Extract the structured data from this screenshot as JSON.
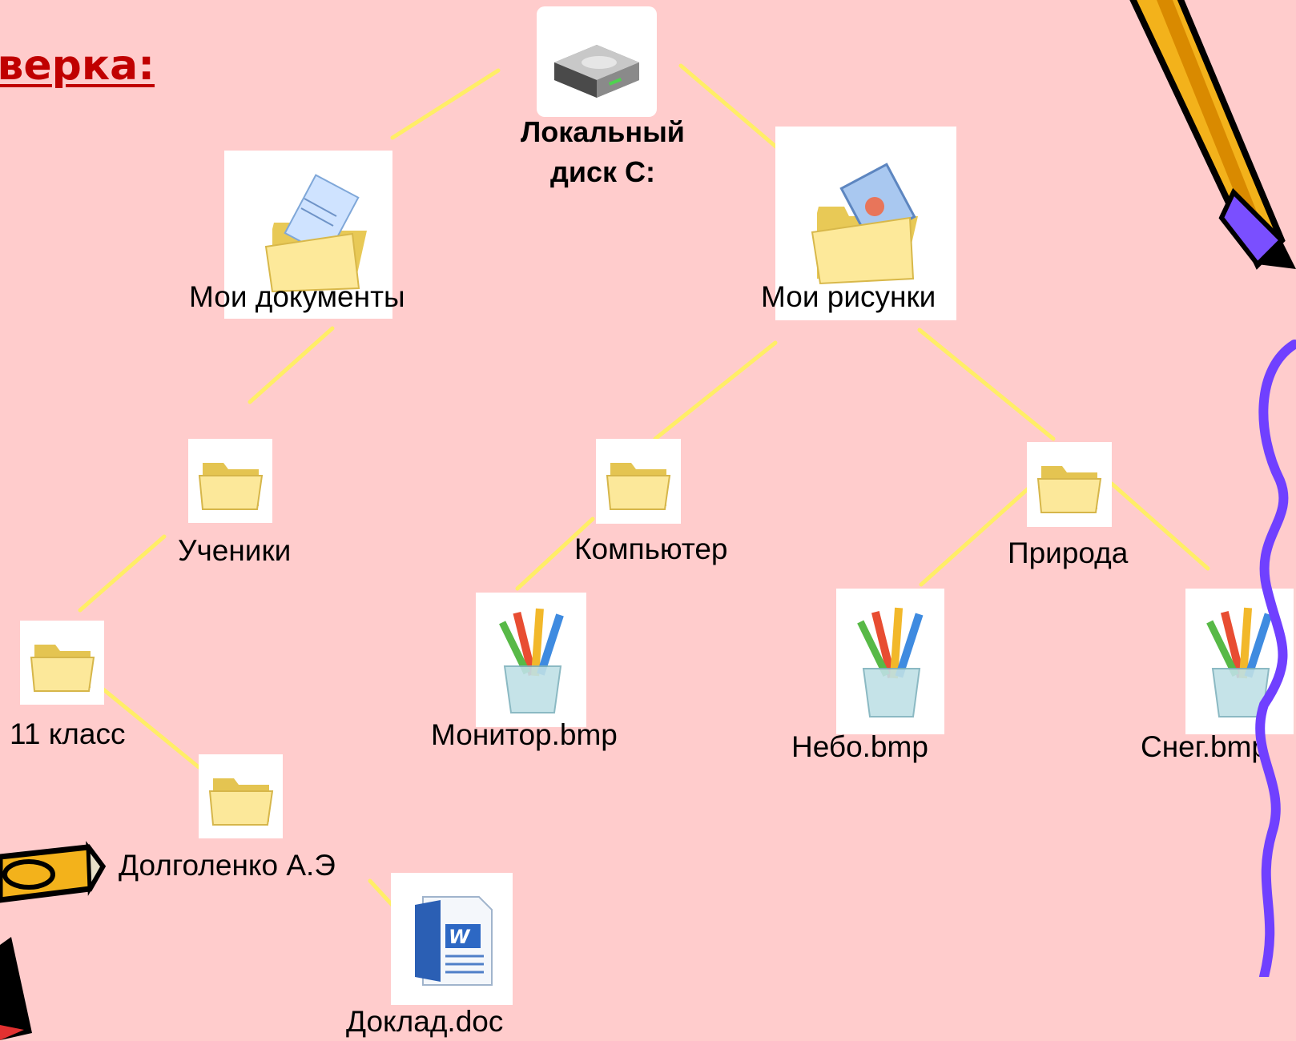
{
  "title": "Проверка:",
  "tree": {
    "root": "Локальный диск С:",
    "my_documents": "Мои документы",
    "my_pictures": "Мои рисунки",
    "pupils": "Ученики",
    "class11": "11 класс",
    "dolgolenko": "Долголенко А.Э",
    "report": "Доклад.doc",
    "computer": "Компьютер",
    "monitor": "Монитор.bmp",
    "nature": "Природа",
    "sky": "Небо.bmp",
    "snow": "Снег.bmp"
  },
  "colors": {
    "background": "#ffcccc",
    "connector": "#ffee66",
    "title": "#c00000"
  },
  "icons": {
    "root": "hard-drive-icon",
    "my_documents": "documents-folder-icon",
    "my_pictures": "pictures-folder-icon",
    "folder": "folder-icon",
    "bitmap": "paint-bitmap-icon",
    "word": "word-document-icon"
  }
}
